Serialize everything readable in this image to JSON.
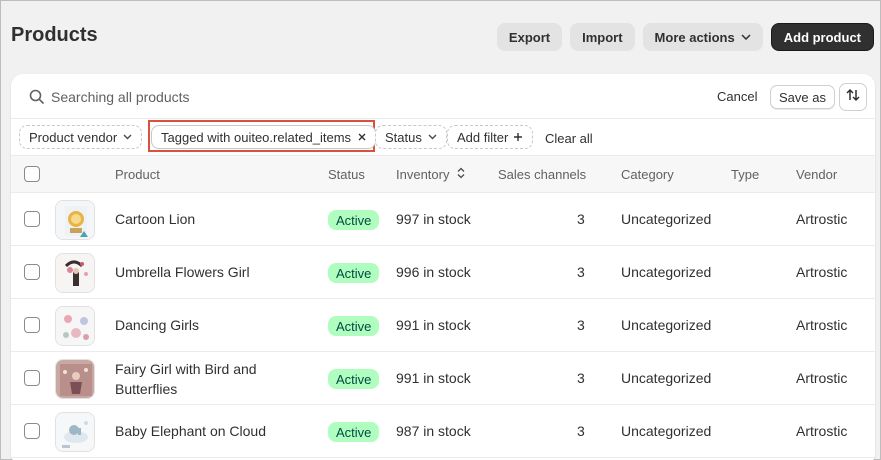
{
  "header": {
    "title": "Products",
    "export_label": "Export",
    "import_label": "Import",
    "more_actions_label": "More actions",
    "add_product_label": "Add product"
  },
  "search": {
    "placeholder": "Searching all products",
    "cancel_label": "Cancel",
    "save_as_label": "Save as"
  },
  "filters": {
    "vendor_label": "Product vendor",
    "tagged_label": "Tagged with ouiteo.related_items",
    "status_label": "Status",
    "add_filter_label": "Add filter",
    "clear_all_label": "Clear all"
  },
  "table": {
    "columns": [
      "Product",
      "Status",
      "Inventory",
      "Sales channels",
      "Category",
      "Type",
      "Vendor"
    ],
    "rows": [
      {
        "product": "Cartoon Lion",
        "product_line2": "",
        "status": "Active",
        "inventory": "997 in stock",
        "channels": "3",
        "category": "Uncategorized",
        "type": "",
        "vendor": "Artrostic"
      },
      {
        "product": "Umbrella Flowers Girl",
        "product_line2": "",
        "status": "Active",
        "inventory": "996 in stock",
        "channels": "3",
        "category": "Uncategorized",
        "type": "",
        "vendor": "Artrostic"
      },
      {
        "product": "Dancing Girls",
        "product_line2": "",
        "status": "Active",
        "inventory": "991 in stock",
        "channels": "3",
        "category": "Uncategorized",
        "type": "",
        "vendor": "Artrostic"
      },
      {
        "product": "Fairy Girl with Bird and",
        "product_line2": "Butterflies",
        "status": "Active",
        "inventory": "991 in stock",
        "channels": "3",
        "category": "Uncategorized",
        "type": "",
        "vendor": "Artrostic"
      },
      {
        "product": "Baby Elephant on Cloud",
        "product_line2": "",
        "status": "Active",
        "inventory": "987 in stock",
        "channels": "3",
        "category": "Uncategorized",
        "type": "",
        "vendor": "Artrostic"
      }
    ]
  },
  "colors": {
    "primary_button": "#303030",
    "status_active_bg": "#affebf",
    "highlight_border": "#d9533c"
  }
}
